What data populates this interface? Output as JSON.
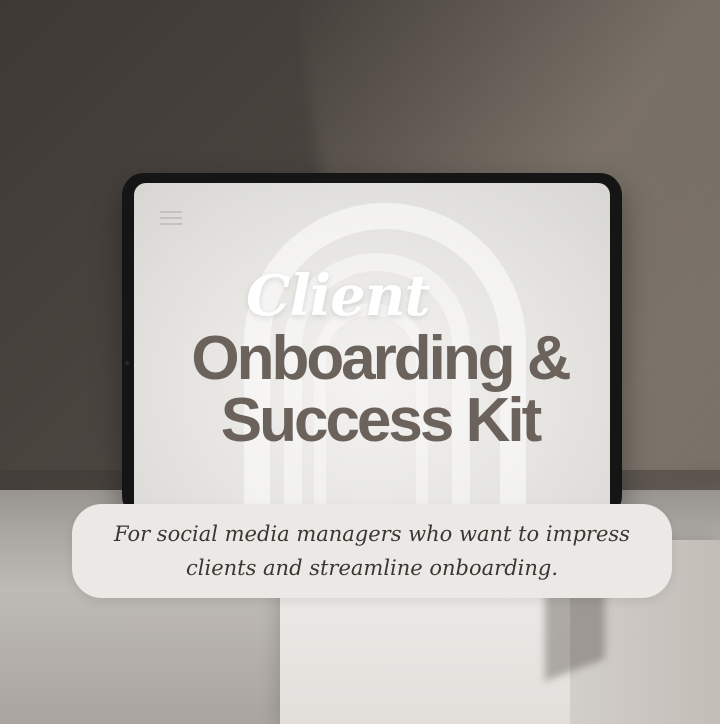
{
  "headline": {
    "script_word": "Client",
    "line1": "Onboarding &",
    "line2": "Success Kit"
  },
  "tagline": {
    "text": "For social media managers who want to impress clients and streamline onboarding."
  },
  "colors": {
    "title_gray": "#6a625b",
    "pill_bg": "#ebe9e6",
    "wall_dark": "#3e3935"
  }
}
